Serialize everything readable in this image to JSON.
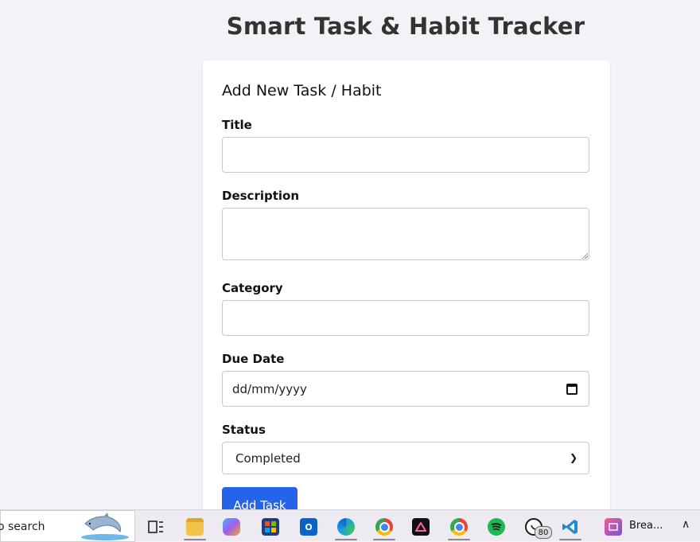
{
  "header": {
    "title": "Smart Task & Habit Tracker"
  },
  "form": {
    "heading": "Add New Task / Habit",
    "title_label": "Title",
    "title_value": "",
    "description_label": "Description",
    "description_value": "",
    "category_label": "Category",
    "category_value": "",
    "due_date_label": "Due Date",
    "due_date_placeholder": "dd/mm/yyyy",
    "status_label": "Status",
    "status_selected": "Completed",
    "submit_label": "Add Task"
  },
  "colors": {
    "accent": "#2563eb",
    "page_bg": "#f2f3f6"
  },
  "taskbar": {
    "search_text": "o search",
    "whatsapp_badge": "80",
    "active_app_label": "Brea...",
    "icons": [
      "task-view-icon",
      "file-explorer-icon",
      "copilot-icon",
      "microsoft-store-icon",
      "outlook-icon",
      "edge-icon",
      "chrome-icon",
      "affinity-icon",
      "chrome-profile-icon",
      "spotify-icon",
      "whatsapp-icon",
      "vscode-icon",
      "app-icon",
      "show-hidden-icons-icon"
    ]
  }
}
